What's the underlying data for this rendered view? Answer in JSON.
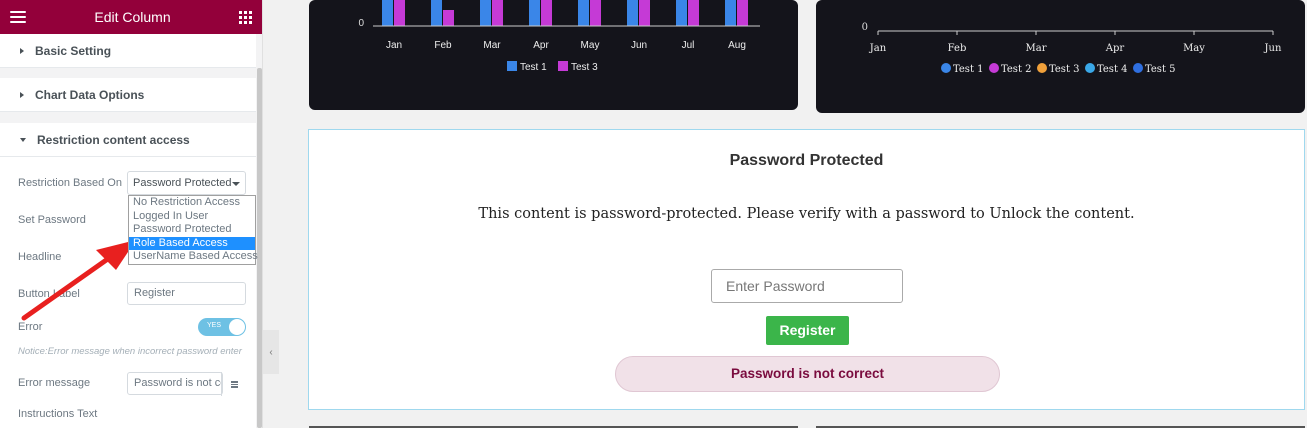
{
  "panel": {
    "title": "Edit Column",
    "sections": [
      "Basic Setting",
      "Chart Data Options",
      "Restriction content access"
    ],
    "restriction_label": "Restriction Based On",
    "restriction_value": "Password Protected",
    "dropdown_options": [
      "No Restriction Access",
      "Logged In User",
      "Password Protected",
      "Role Based Access",
      "UserName Based Access"
    ],
    "set_password_label": "Set Password",
    "headline_label": "Headline",
    "button_label_label": "Button Label",
    "button_label_value": "Register",
    "error_label": "Error",
    "toggle_text": "YES",
    "notice": "Notice:Error message when incorrect password enter",
    "error_message_label": "Error message",
    "error_message_value": "Password is not correct",
    "instructions_label": "Instructions Text"
  },
  "chart_data": [
    {
      "type": "bar",
      "categories": [
        "Jan",
        "Feb",
        "Mar",
        "Apr",
        "May",
        "Jun",
        "Jul",
        "Aug"
      ],
      "series": [
        {
          "name": "Test 1",
          "color": "#3a86e8"
        },
        {
          "name": "Test 3",
          "color": "#c53ad6"
        }
      ],
      "y_tick": "0"
    },
    {
      "type": "line",
      "categories": [
        "Jan",
        "Feb",
        "Mar",
        "Apr",
        "May",
        "Jun"
      ],
      "series": [
        {
          "name": "Test 1",
          "color": "#3a86e8"
        },
        {
          "name": "Test 2",
          "color": "#c53ad6"
        },
        {
          "name": "Test 3",
          "color": "#f0a03a"
        },
        {
          "name": "Test 4",
          "color": "#3aa8e8"
        },
        {
          "name": "Test 5",
          "color": "#2f6fe0"
        }
      ],
      "y_tick": "0"
    }
  ],
  "protected": {
    "title": "Password Protected",
    "description": "This content is password-protected. Please verify with a password to Unlock the content.",
    "input_placeholder": "Enter Password",
    "button": "Register",
    "error": "Password is not correct"
  }
}
